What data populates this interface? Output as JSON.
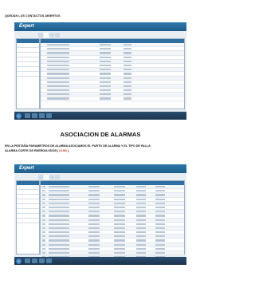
{
  "captions": {
    "top": "QUEDAN LOS CONTACTOS ABIERTOS"
  },
  "section": {
    "title": "ASOCIACION DE ALARMAS",
    "paragraph_line1": "EN LA PESTAÑA PARAMETROS DE ALARMA ASOCIAMOS EL PURTO DE ALARMA Y EL TIPO DE FALLA",
    "paragraph_line2_prefix": "ALARMA CORTE DE ENERGIA 65105 (",
    "paragraph_highlight": "ALM1",
    "paragraph_line2_suffix": ")"
  },
  "screenshots": [
    {
      "app_name": "Expert",
      "tabs": [
        "",
        "",
        "",
        ""
      ],
      "rows": 14
    },
    {
      "app_name": "Expert",
      "tabs": [
        "",
        "",
        "",
        ""
      ],
      "rows": 24
    }
  ]
}
